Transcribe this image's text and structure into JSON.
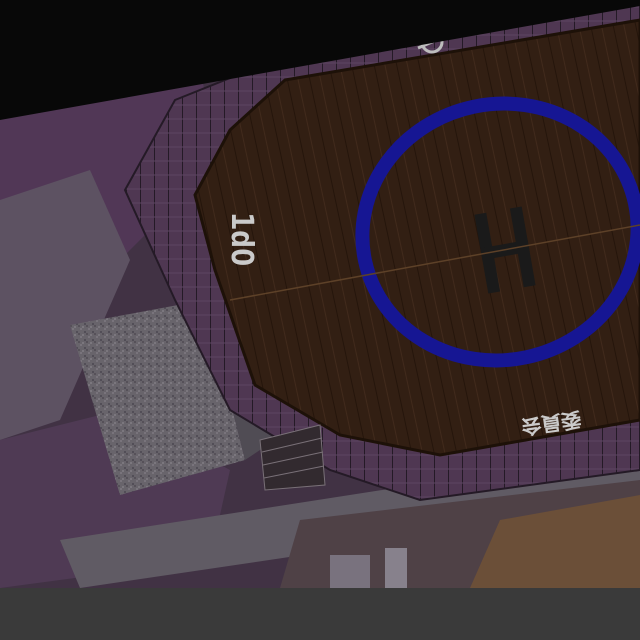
{
  "scene": {
    "helipad": {
      "code_label": "1dO",
      "center_marking": "H",
      "edge_label": "委員会"
    }
  },
  "colors": {
    "deck": "#3a2416",
    "deck_plank": "#4a3020",
    "ring": "#1a1aa8",
    "h_marking": "#1e1e1e",
    "text": "#e6e6e6",
    "ground_purple": "#5d3f62",
    "ground_light": "#6a6470",
    "top_band": "#0a0a0a"
  }
}
